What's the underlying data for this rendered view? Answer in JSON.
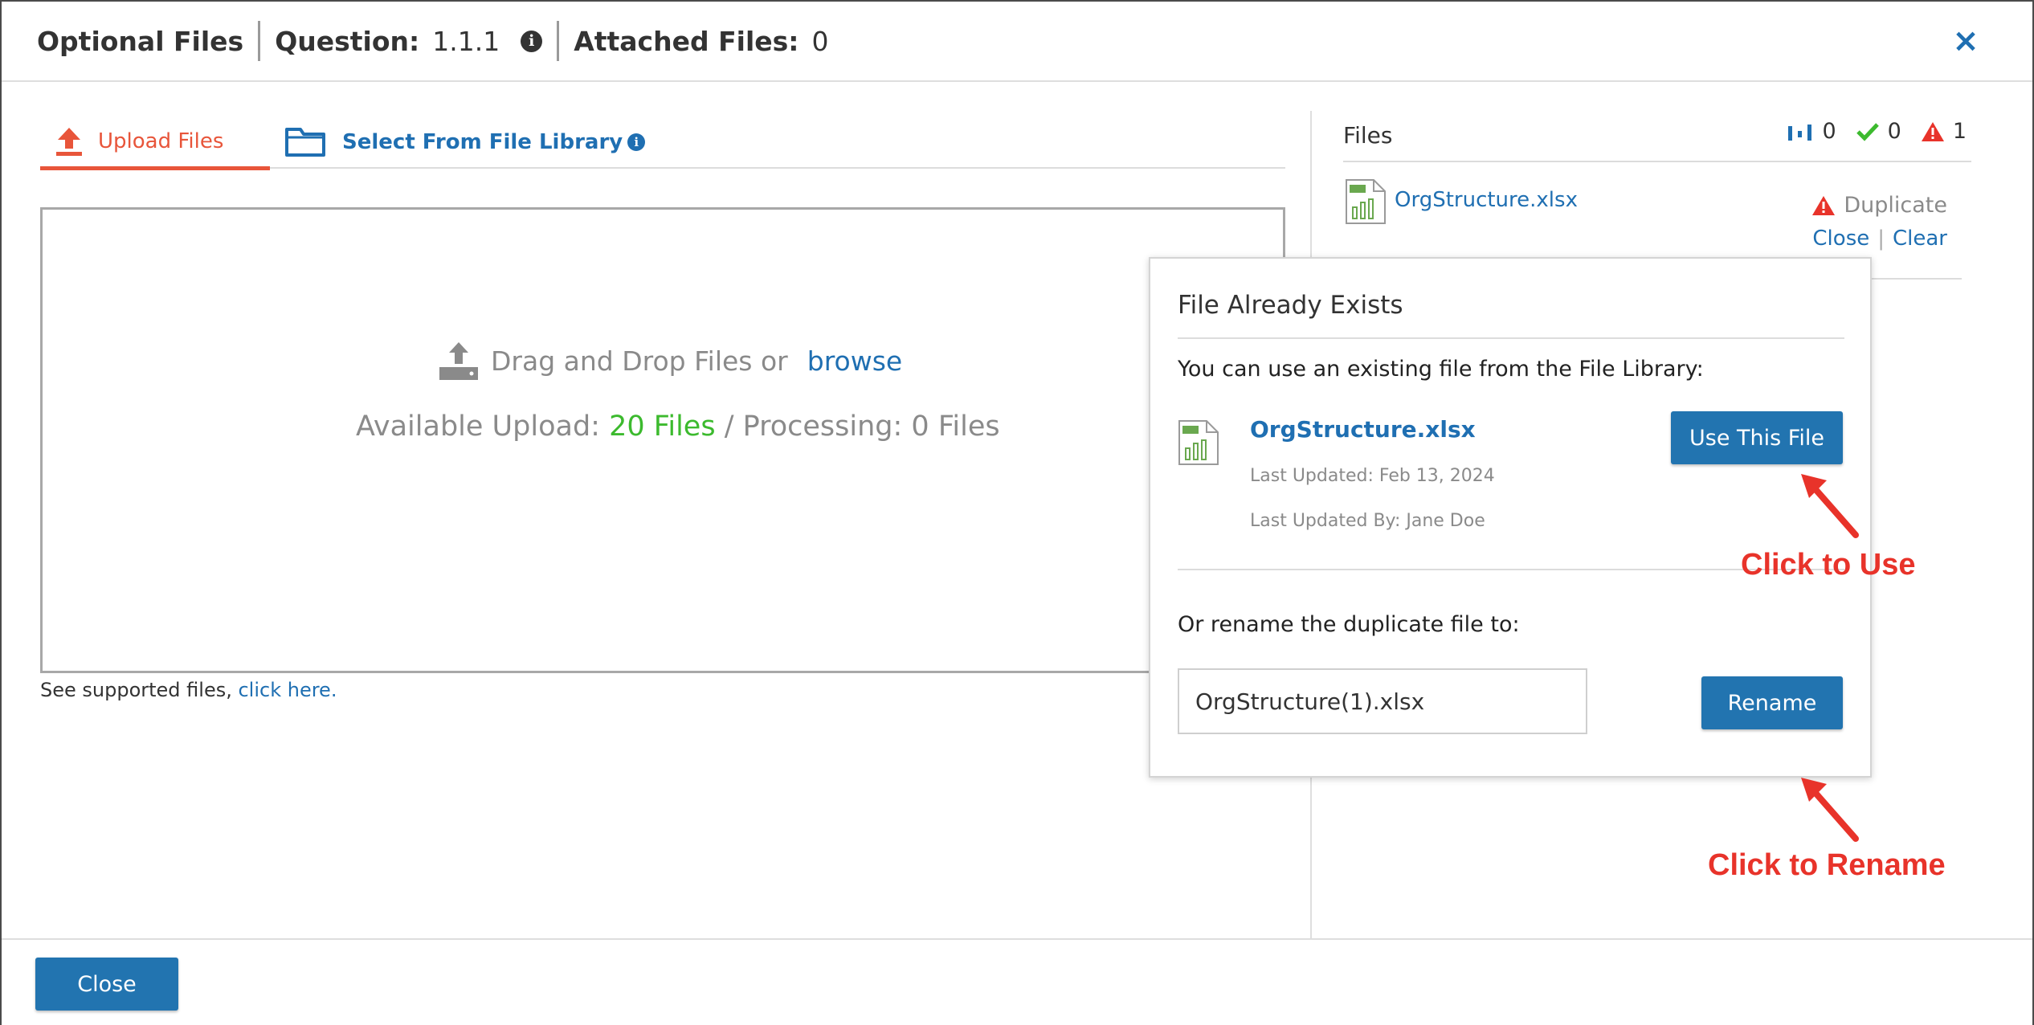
{
  "header": {
    "optional_files": "Optional Files",
    "question_label": "Question:",
    "question_value": "1.1.1",
    "info_icon_char": "i",
    "attached_label": "Attached Files:",
    "attached_value": "0",
    "close_icon": "×"
  },
  "tabs": {
    "upload": "Upload Files",
    "library": "Select From File Library",
    "library_info_char": "i"
  },
  "dropzone": {
    "drag_text": "Drag and Drop Files or",
    "browse": "browse",
    "available_label": "Available Upload: ",
    "available_value": "20 Files",
    "processing_text": " / Processing: 0 Files",
    "supported_text": "See supported files, ",
    "supported_link": "click here."
  },
  "files_panel": {
    "title": "Files",
    "counts": {
      "uploading": "0",
      "success": "0",
      "warning": "1"
    },
    "file": {
      "name": "OrgStructure.xlsx",
      "status": "Duplicate",
      "close_link": "Close",
      "separator": "|",
      "clear_link": "Clear"
    }
  },
  "popup": {
    "title": "File Already Exists",
    "description": "You can use an existing file from the File Library:",
    "file_name": "OrgStructure.xlsx",
    "last_updated": "Last Updated: Feb 13, 2024",
    "last_updated_by": "Last Updated By: Jane Doe",
    "use_button": "Use This File",
    "rename_label": "Or rename the duplicate file to:",
    "rename_value": "OrgStructure(1).xlsx",
    "rename_button": "Rename"
  },
  "annotations": {
    "click_to_use": "Click to Use",
    "click_to_rename": "Click to Rename"
  },
  "footer": {
    "close_button": "Close"
  },
  "colors": {
    "accent_blue": "#1f6fb2",
    "button_blue": "#2274b0",
    "upload_orange": "#e8553a",
    "success_green": "#3cba2e",
    "warning_red": "#e8332a"
  }
}
